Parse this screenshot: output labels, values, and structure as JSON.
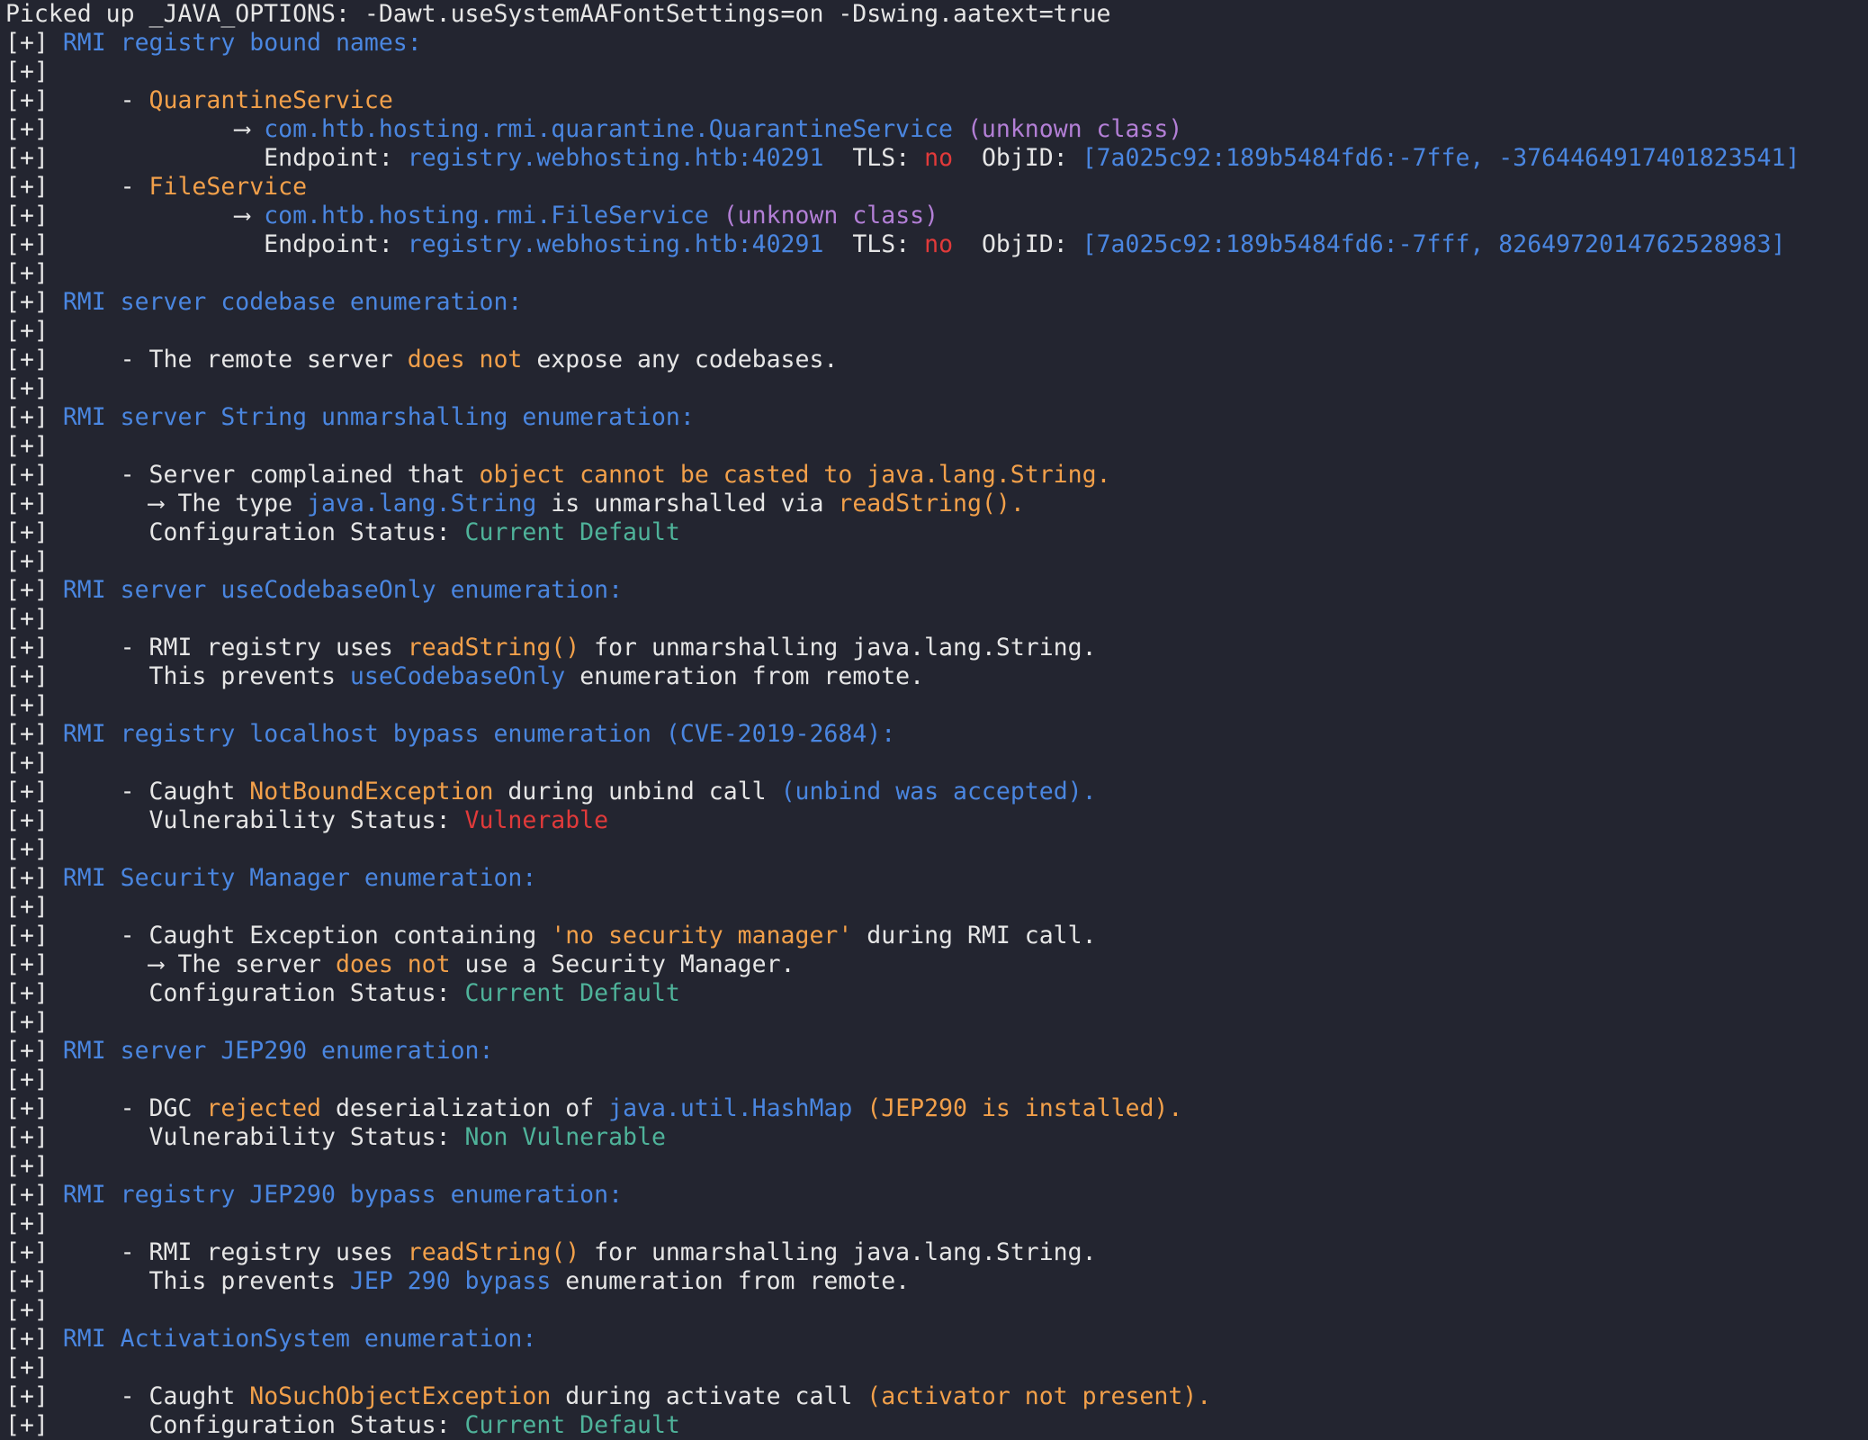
{
  "colors": {
    "background": "#232530",
    "white": "#e6e6e6",
    "blue": "#4a86e0",
    "orange": "#f2a04a",
    "red": "#e13a3a",
    "green": "#4fb39a",
    "purple": "#b37fd6"
  },
  "lines": [
    {
      "segments": [
        {
          "c": "w",
          "t": "Picked up _JAVA_OPTIONS: -Dawt.useSystemAAFontSettings=on -Dswing.aatext=true"
        }
      ]
    },
    {
      "segments": [
        {
          "c": "w",
          "t": "[+] "
        },
        {
          "c": "b",
          "t": "RMI registry bound names:"
        }
      ]
    },
    {
      "segments": [
        {
          "c": "w",
          "t": "[+]"
        }
      ]
    },
    {
      "segments": [
        {
          "c": "w",
          "t": "[+]     - "
        },
        {
          "c": "o",
          "t": "QuarantineService"
        }
      ]
    },
    {
      "segments": [
        {
          "c": "w",
          "t": "[+]             ⟶ "
        },
        {
          "c": "b",
          "t": "com.htb.hosting.rmi.quarantine.QuarantineService"
        },
        {
          "c": "w",
          "t": " "
        },
        {
          "c": "p",
          "t": "(unknown class)"
        }
      ]
    },
    {
      "segments": [
        {
          "c": "w",
          "t": "[+]               Endpoint: "
        },
        {
          "c": "b",
          "t": "registry.webhosting.htb:40291"
        },
        {
          "c": "w",
          "t": "  TLS: "
        },
        {
          "c": "r",
          "t": "no"
        },
        {
          "c": "w",
          "t": "  ObjID: "
        },
        {
          "c": "b",
          "t": "[7a025c92:189b5484fd6:-7ffe, -3764464917401823541]"
        }
      ]
    },
    {
      "segments": [
        {
          "c": "w",
          "t": "[+]     - "
        },
        {
          "c": "o",
          "t": "FileService"
        }
      ]
    },
    {
      "segments": [
        {
          "c": "w",
          "t": "[+]             ⟶ "
        },
        {
          "c": "b",
          "t": "com.htb.hosting.rmi.FileService"
        },
        {
          "c": "w",
          "t": " "
        },
        {
          "c": "p",
          "t": "(unknown class)"
        }
      ]
    },
    {
      "segments": [
        {
          "c": "w",
          "t": "[+]               Endpoint: "
        },
        {
          "c": "b",
          "t": "registry.webhosting.htb:40291"
        },
        {
          "c": "w",
          "t": "  TLS: "
        },
        {
          "c": "r",
          "t": "no"
        },
        {
          "c": "w",
          "t": "  ObjID: "
        },
        {
          "c": "b",
          "t": "[7a025c92:189b5484fd6:-7fff, 8264972014762528983]"
        }
      ]
    },
    {
      "segments": [
        {
          "c": "w",
          "t": "[+]"
        }
      ]
    },
    {
      "segments": [
        {
          "c": "w",
          "t": "[+] "
        },
        {
          "c": "b",
          "t": "RMI server codebase enumeration:"
        }
      ]
    },
    {
      "segments": [
        {
          "c": "w",
          "t": "[+]"
        }
      ]
    },
    {
      "segments": [
        {
          "c": "w",
          "t": "[+]     - The remote server "
        },
        {
          "c": "o",
          "t": "does not"
        },
        {
          "c": "w",
          "t": " expose any codebases."
        }
      ]
    },
    {
      "segments": [
        {
          "c": "w",
          "t": "[+]"
        }
      ]
    },
    {
      "segments": [
        {
          "c": "w",
          "t": "[+] "
        },
        {
          "c": "b",
          "t": "RMI server String unmarshalling enumeration:"
        }
      ]
    },
    {
      "segments": [
        {
          "c": "w",
          "t": "[+]"
        }
      ]
    },
    {
      "segments": [
        {
          "c": "w",
          "t": "[+]     - Server complained that "
        },
        {
          "c": "o",
          "t": "object cannot be casted to java.lang.String."
        }
      ]
    },
    {
      "segments": [
        {
          "c": "w",
          "t": "[+]       ⟶ The type "
        },
        {
          "c": "b",
          "t": "java.lang.String"
        },
        {
          "c": "w",
          "t": " is unmarshalled via "
        },
        {
          "c": "o",
          "t": "readString()."
        }
      ]
    },
    {
      "segments": [
        {
          "c": "w",
          "t": "[+]       Configuration Status: "
        },
        {
          "c": "g",
          "t": "Current Default"
        }
      ]
    },
    {
      "segments": [
        {
          "c": "w",
          "t": "[+]"
        }
      ]
    },
    {
      "segments": [
        {
          "c": "w",
          "t": "[+] "
        },
        {
          "c": "b",
          "t": "RMI server useCodebaseOnly enumeration:"
        }
      ]
    },
    {
      "segments": [
        {
          "c": "w",
          "t": "[+]"
        }
      ]
    },
    {
      "segments": [
        {
          "c": "w",
          "t": "[+]     - RMI registry uses "
        },
        {
          "c": "o",
          "t": "readString()"
        },
        {
          "c": "w",
          "t": " for unmarshalling java.lang.String."
        }
      ]
    },
    {
      "segments": [
        {
          "c": "w",
          "t": "[+]       This prevents "
        },
        {
          "c": "b",
          "t": "useCodebaseOnly"
        },
        {
          "c": "w",
          "t": " enumeration from remote."
        }
      ]
    },
    {
      "segments": [
        {
          "c": "w",
          "t": "[+]"
        }
      ]
    },
    {
      "segments": [
        {
          "c": "w",
          "t": "[+] "
        },
        {
          "c": "b",
          "t": "RMI registry localhost bypass enumeration (CVE-2019-2684):"
        }
      ]
    },
    {
      "segments": [
        {
          "c": "w",
          "t": "[+]"
        }
      ]
    },
    {
      "segments": [
        {
          "c": "w",
          "t": "[+]     - Caught "
        },
        {
          "c": "o",
          "t": "NotBoundException"
        },
        {
          "c": "w",
          "t": " during unbind call "
        },
        {
          "c": "b",
          "t": "(unbind was accepted)."
        }
      ]
    },
    {
      "segments": [
        {
          "c": "w",
          "t": "[+]       Vulnerability Status: "
        },
        {
          "c": "r",
          "t": "Vulnerable"
        }
      ]
    },
    {
      "segments": [
        {
          "c": "w",
          "t": "[+]"
        }
      ]
    },
    {
      "segments": [
        {
          "c": "w",
          "t": "[+] "
        },
        {
          "c": "b",
          "t": "RMI Security Manager enumeration:"
        }
      ]
    },
    {
      "segments": [
        {
          "c": "w",
          "t": "[+]"
        }
      ]
    },
    {
      "segments": [
        {
          "c": "w",
          "t": "[+]     - Caught Exception containing "
        },
        {
          "c": "o",
          "t": "'no security manager'"
        },
        {
          "c": "w",
          "t": " during RMI call."
        }
      ]
    },
    {
      "segments": [
        {
          "c": "w",
          "t": "[+]       ⟶ The server "
        },
        {
          "c": "o",
          "t": "does not"
        },
        {
          "c": "w",
          "t": " use a Security Manager."
        }
      ]
    },
    {
      "segments": [
        {
          "c": "w",
          "t": "[+]       Configuration Status: "
        },
        {
          "c": "g",
          "t": "Current Default"
        }
      ]
    },
    {
      "segments": [
        {
          "c": "w",
          "t": "[+]"
        }
      ]
    },
    {
      "segments": [
        {
          "c": "w",
          "t": "[+] "
        },
        {
          "c": "b",
          "t": "RMI server JEP290 enumeration:"
        }
      ]
    },
    {
      "segments": [
        {
          "c": "w",
          "t": "[+]"
        }
      ]
    },
    {
      "segments": [
        {
          "c": "w",
          "t": "[+]     - DGC "
        },
        {
          "c": "o",
          "t": "rejected"
        },
        {
          "c": "w",
          "t": " deserialization of "
        },
        {
          "c": "b",
          "t": "java.util.HashMap"
        },
        {
          "c": "w",
          "t": " "
        },
        {
          "c": "o",
          "t": "(JEP290 is installed)."
        }
      ]
    },
    {
      "segments": [
        {
          "c": "w",
          "t": "[+]       Vulnerability Status: "
        },
        {
          "c": "g",
          "t": "Non Vulnerable"
        }
      ]
    },
    {
      "segments": [
        {
          "c": "w",
          "t": "[+]"
        }
      ]
    },
    {
      "segments": [
        {
          "c": "w",
          "t": "[+] "
        },
        {
          "c": "b",
          "t": "RMI registry JEP290 bypass enumeration:"
        }
      ]
    },
    {
      "segments": [
        {
          "c": "w",
          "t": "[+]"
        }
      ]
    },
    {
      "segments": [
        {
          "c": "w",
          "t": "[+]     - RMI registry uses "
        },
        {
          "c": "o",
          "t": "readString()"
        },
        {
          "c": "w",
          "t": " for unmarshalling java.lang.String."
        }
      ]
    },
    {
      "segments": [
        {
          "c": "w",
          "t": "[+]       This prevents "
        },
        {
          "c": "b",
          "t": "JEP 290 bypass"
        },
        {
          "c": "w",
          "t": " enumeration from remote."
        }
      ]
    },
    {
      "segments": [
        {
          "c": "w",
          "t": "[+]"
        }
      ]
    },
    {
      "segments": [
        {
          "c": "w",
          "t": "[+] "
        },
        {
          "c": "b",
          "t": "RMI ActivationSystem enumeration:"
        }
      ]
    },
    {
      "segments": [
        {
          "c": "w",
          "t": "[+]"
        }
      ]
    },
    {
      "segments": [
        {
          "c": "w",
          "t": "[+]     - Caught "
        },
        {
          "c": "o",
          "t": "NoSuchObjectException"
        },
        {
          "c": "w",
          "t": " during activate call "
        },
        {
          "c": "o",
          "t": "(activator not present)."
        }
      ]
    },
    {
      "segments": [
        {
          "c": "w",
          "t": "[+]       Configuration Status: "
        },
        {
          "c": "g",
          "t": "Current Default"
        }
      ]
    }
  ]
}
